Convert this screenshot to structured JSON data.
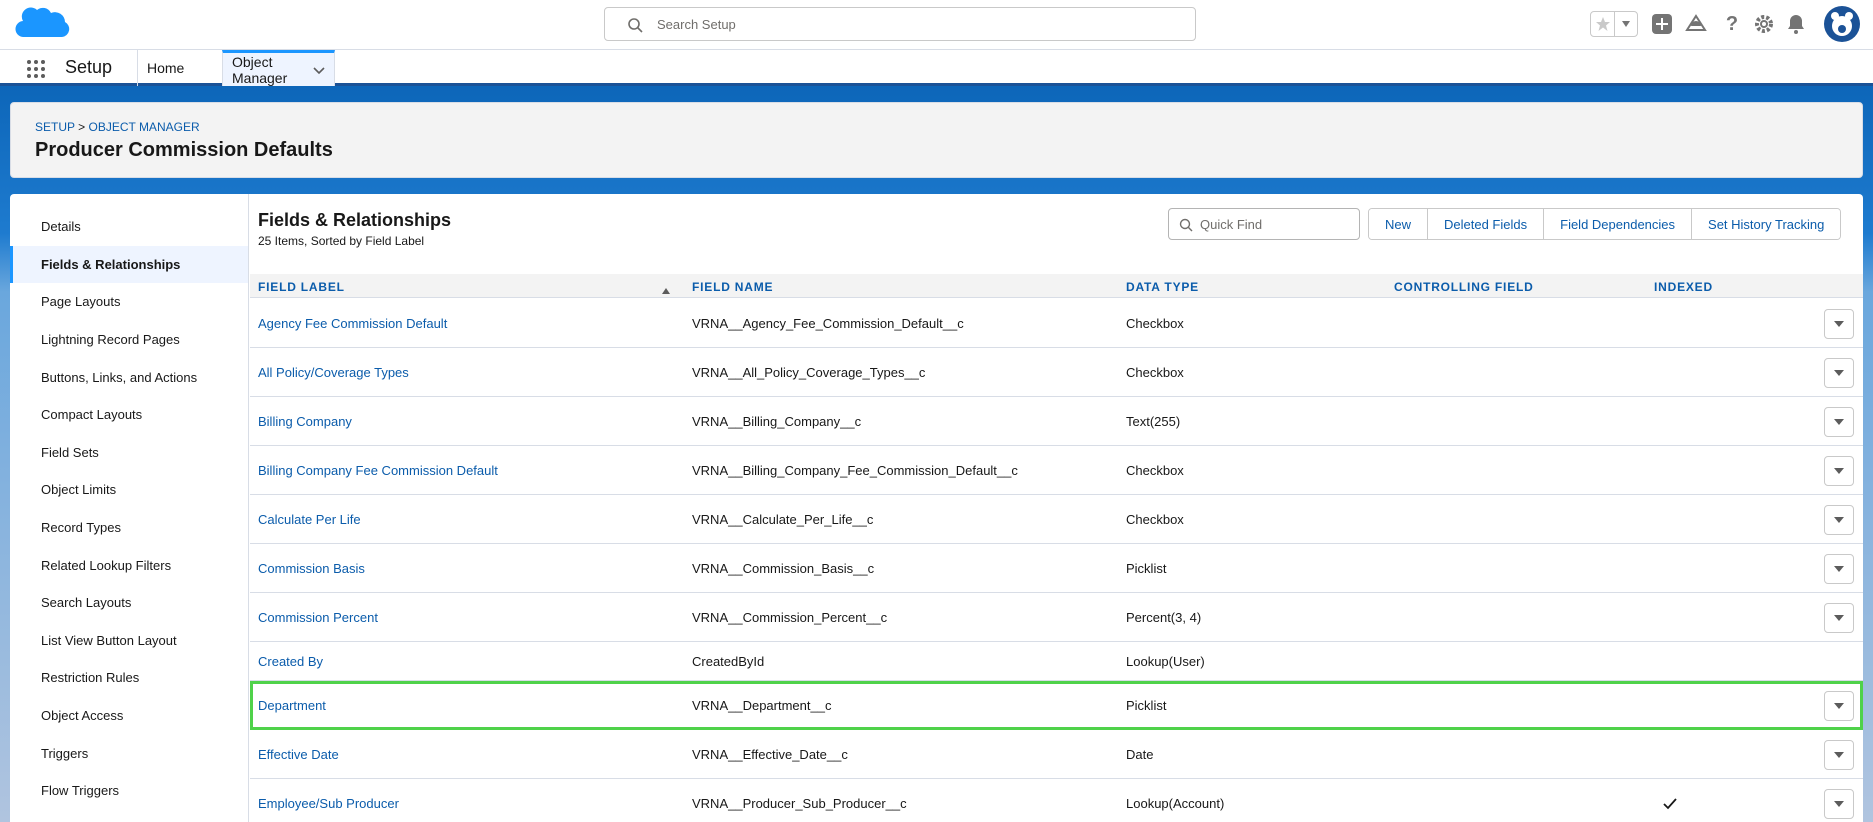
{
  "header": {
    "search_placeholder": "Search Setup",
    "icons": [
      "salesforce-cloud-logo",
      "search-icon",
      "star-icon",
      "chevron-down-icon",
      "add-icon",
      "trailhead-icon",
      "help-icon",
      "gear-icon",
      "bell-icon",
      "avatar"
    ]
  },
  "context_bar": {
    "app_name": "Setup",
    "tabs": [
      {
        "label": "Home"
      },
      {
        "label": "Object Manager"
      }
    ]
  },
  "page_header": {
    "breadcrumb_setup": "SETUP",
    "breadcrumb_sep": " > ",
    "breadcrumb_object_manager": "OBJECT MANAGER",
    "title": "Producer Commission Defaults"
  },
  "sidebar": {
    "items": [
      {
        "label": "Details"
      },
      {
        "label": "Fields & Relationships",
        "active": true
      },
      {
        "label": "Page Layouts"
      },
      {
        "label": "Lightning Record Pages"
      },
      {
        "label": "Buttons, Links, and Actions"
      },
      {
        "label": "Compact Layouts"
      },
      {
        "label": "Field Sets"
      },
      {
        "label": "Object Limits"
      },
      {
        "label": "Record Types"
      },
      {
        "label": "Related Lookup Filters"
      },
      {
        "label": "Search Layouts"
      },
      {
        "label": "List View Button Layout"
      },
      {
        "label": "Restriction Rules"
      },
      {
        "label": "Object Access"
      },
      {
        "label": "Triggers"
      },
      {
        "label": "Flow Triggers"
      }
    ]
  },
  "section": {
    "title": "Fields & Relationships",
    "subtitle": "25 Items, Sorted by Field Label",
    "quick_find_placeholder": "Quick Find",
    "buttons": [
      "New",
      "Deleted Fields",
      "Field Dependencies",
      "Set History Tracking"
    ]
  },
  "table": {
    "columns": [
      "FIELD LABEL",
      "FIELD NAME",
      "DATA TYPE",
      "CONTROLLING FIELD",
      "INDEXED"
    ],
    "rows": [
      {
        "label": "Agency Fee Commission Default",
        "name": "VRNA__Agency_Fee_Commission_Default__c",
        "type": "Checkbox",
        "controlling": "",
        "indexed": false,
        "menu": true
      },
      {
        "label": "All Policy/Coverage Types",
        "name": "VRNA__All_Policy_Coverage_Types__c",
        "type": "Checkbox",
        "controlling": "",
        "indexed": false,
        "menu": true
      },
      {
        "label": "Billing Company",
        "name": "VRNA__Billing_Company__c",
        "type": "Text(255)",
        "controlling": "",
        "indexed": false,
        "menu": true
      },
      {
        "label": "Billing Company Fee Commission Default",
        "name": "VRNA__Billing_Company_Fee_Commission_Default__c",
        "type": "Checkbox",
        "controlling": "",
        "indexed": false,
        "menu": true
      },
      {
        "label": "Calculate Per Life",
        "name": "VRNA__Calculate_Per_Life__c",
        "type": "Checkbox",
        "controlling": "",
        "indexed": false,
        "menu": true
      },
      {
        "label": "Commission Basis",
        "name": "VRNA__Commission_Basis__c",
        "type": "Picklist",
        "controlling": "",
        "indexed": false,
        "menu": true
      },
      {
        "label": "Commission Percent",
        "name": "VRNA__Commission_Percent__c",
        "type": "Percent(3, 4)",
        "controlling": "",
        "indexed": false,
        "menu": true
      },
      {
        "label": "Created By",
        "name": "CreatedById",
        "type": "Lookup(User)",
        "controlling": "",
        "indexed": false,
        "menu": false
      },
      {
        "label": "Department",
        "name": "VRNA__Department__c",
        "type": "Picklist",
        "controlling": "",
        "indexed": false,
        "menu": true,
        "highlight": true
      },
      {
        "label": "Effective Date",
        "name": "VRNA__Effective_Date__c",
        "type": "Date",
        "controlling": "",
        "indexed": false,
        "menu": true
      },
      {
        "label": "Employee/Sub Producer",
        "name": "VRNA__Producer_Sub_Producer__c",
        "type": "Lookup(Account)",
        "controlling": "",
        "indexed": true,
        "menu": true
      }
    ]
  },
  "colors": {
    "link": "#0b5cab",
    "brand_blue": "#1b96ff",
    "highlight_outline": "#4fd24a",
    "header_band": "#0d66b9"
  }
}
